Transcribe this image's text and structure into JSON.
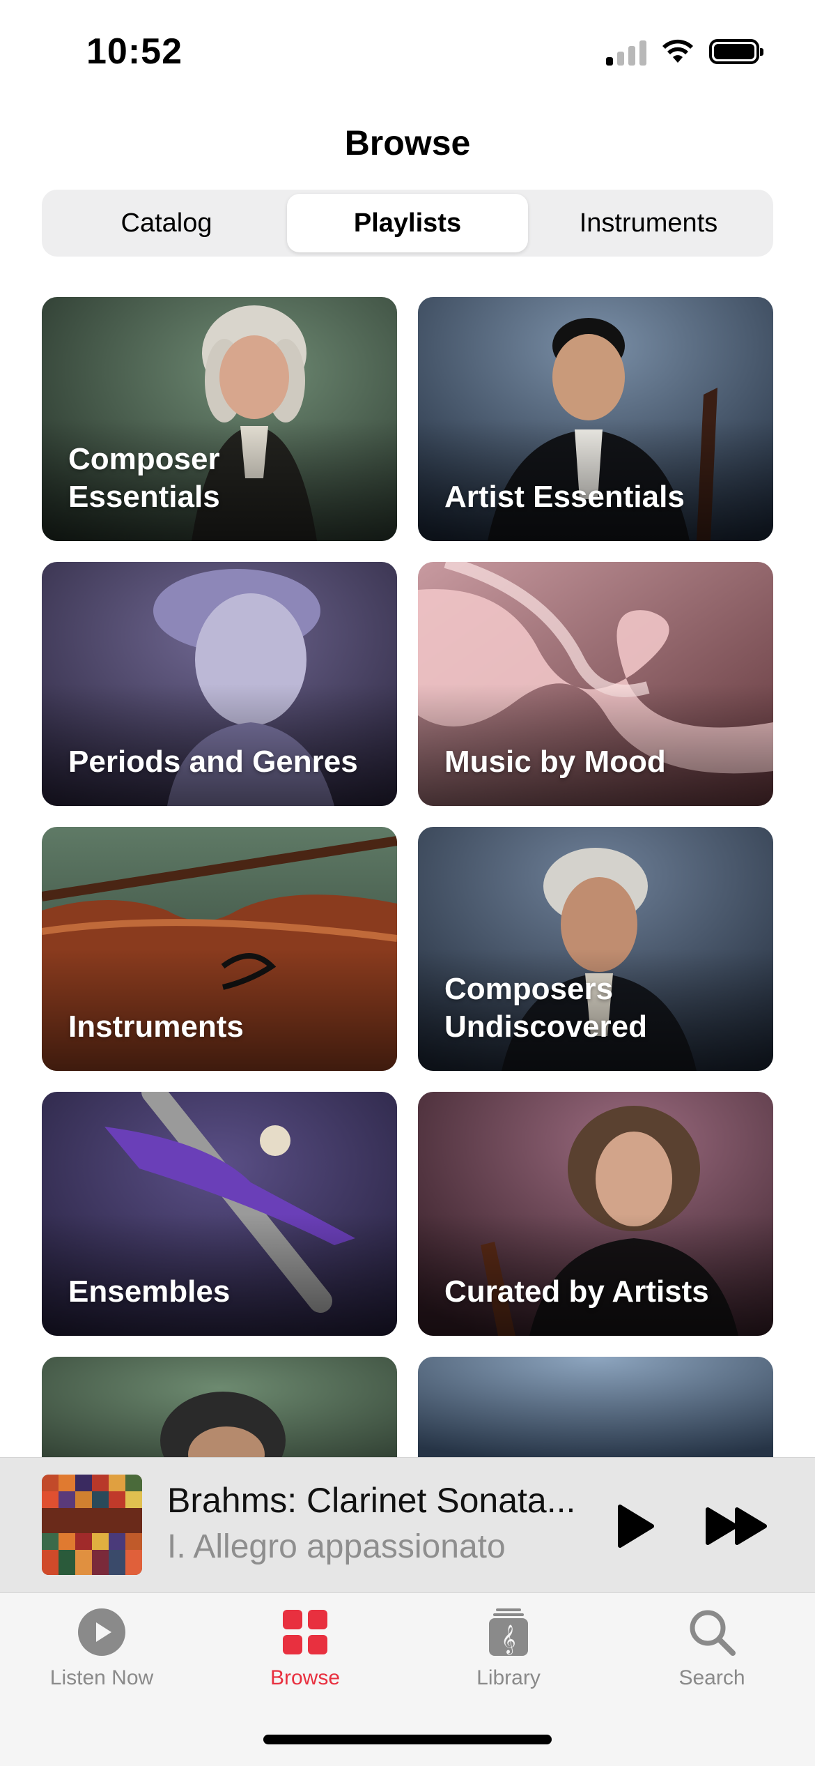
{
  "status_bar": {
    "time": "10:52"
  },
  "header": {
    "title": "Browse"
  },
  "segmented": {
    "tabs": [
      "Catalog",
      "Playlists",
      "Instruments"
    ],
    "selected": "Playlists"
  },
  "cards": [
    {
      "label": "Composer\nEssentials"
    },
    {
      "label": "Artist Essentials"
    },
    {
      "label": "Periods and Genres"
    },
    {
      "label": "Music by Mood"
    },
    {
      "label": "Instruments"
    },
    {
      "label": "Composers\nUndiscovered"
    },
    {
      "label": "Ensembles"
    },
    {
      "label": "Curated by Artists"
    }
  ],
  "mini_player": {
    "title": "Brahms: Clarinet Sonata...",
    "subtitle": "I. Allegro appassionato"
  },
  "tab_bar": {
    "items": [
      {
        "label": "Listen Now",
        "icon": "play-circle-icon"
      },
      {
        "label": "Browse",
        "icon": "grid-icon"
      },
      {
        "label": "Library",
        "icon": "library-icon"
      },
      {
        "label": "Search",
        "icon": "search-icon"
      }
    ],
    "selected": "Browse"
  },
  "colors": {
    "accent": "#e8303f"
  }
}
